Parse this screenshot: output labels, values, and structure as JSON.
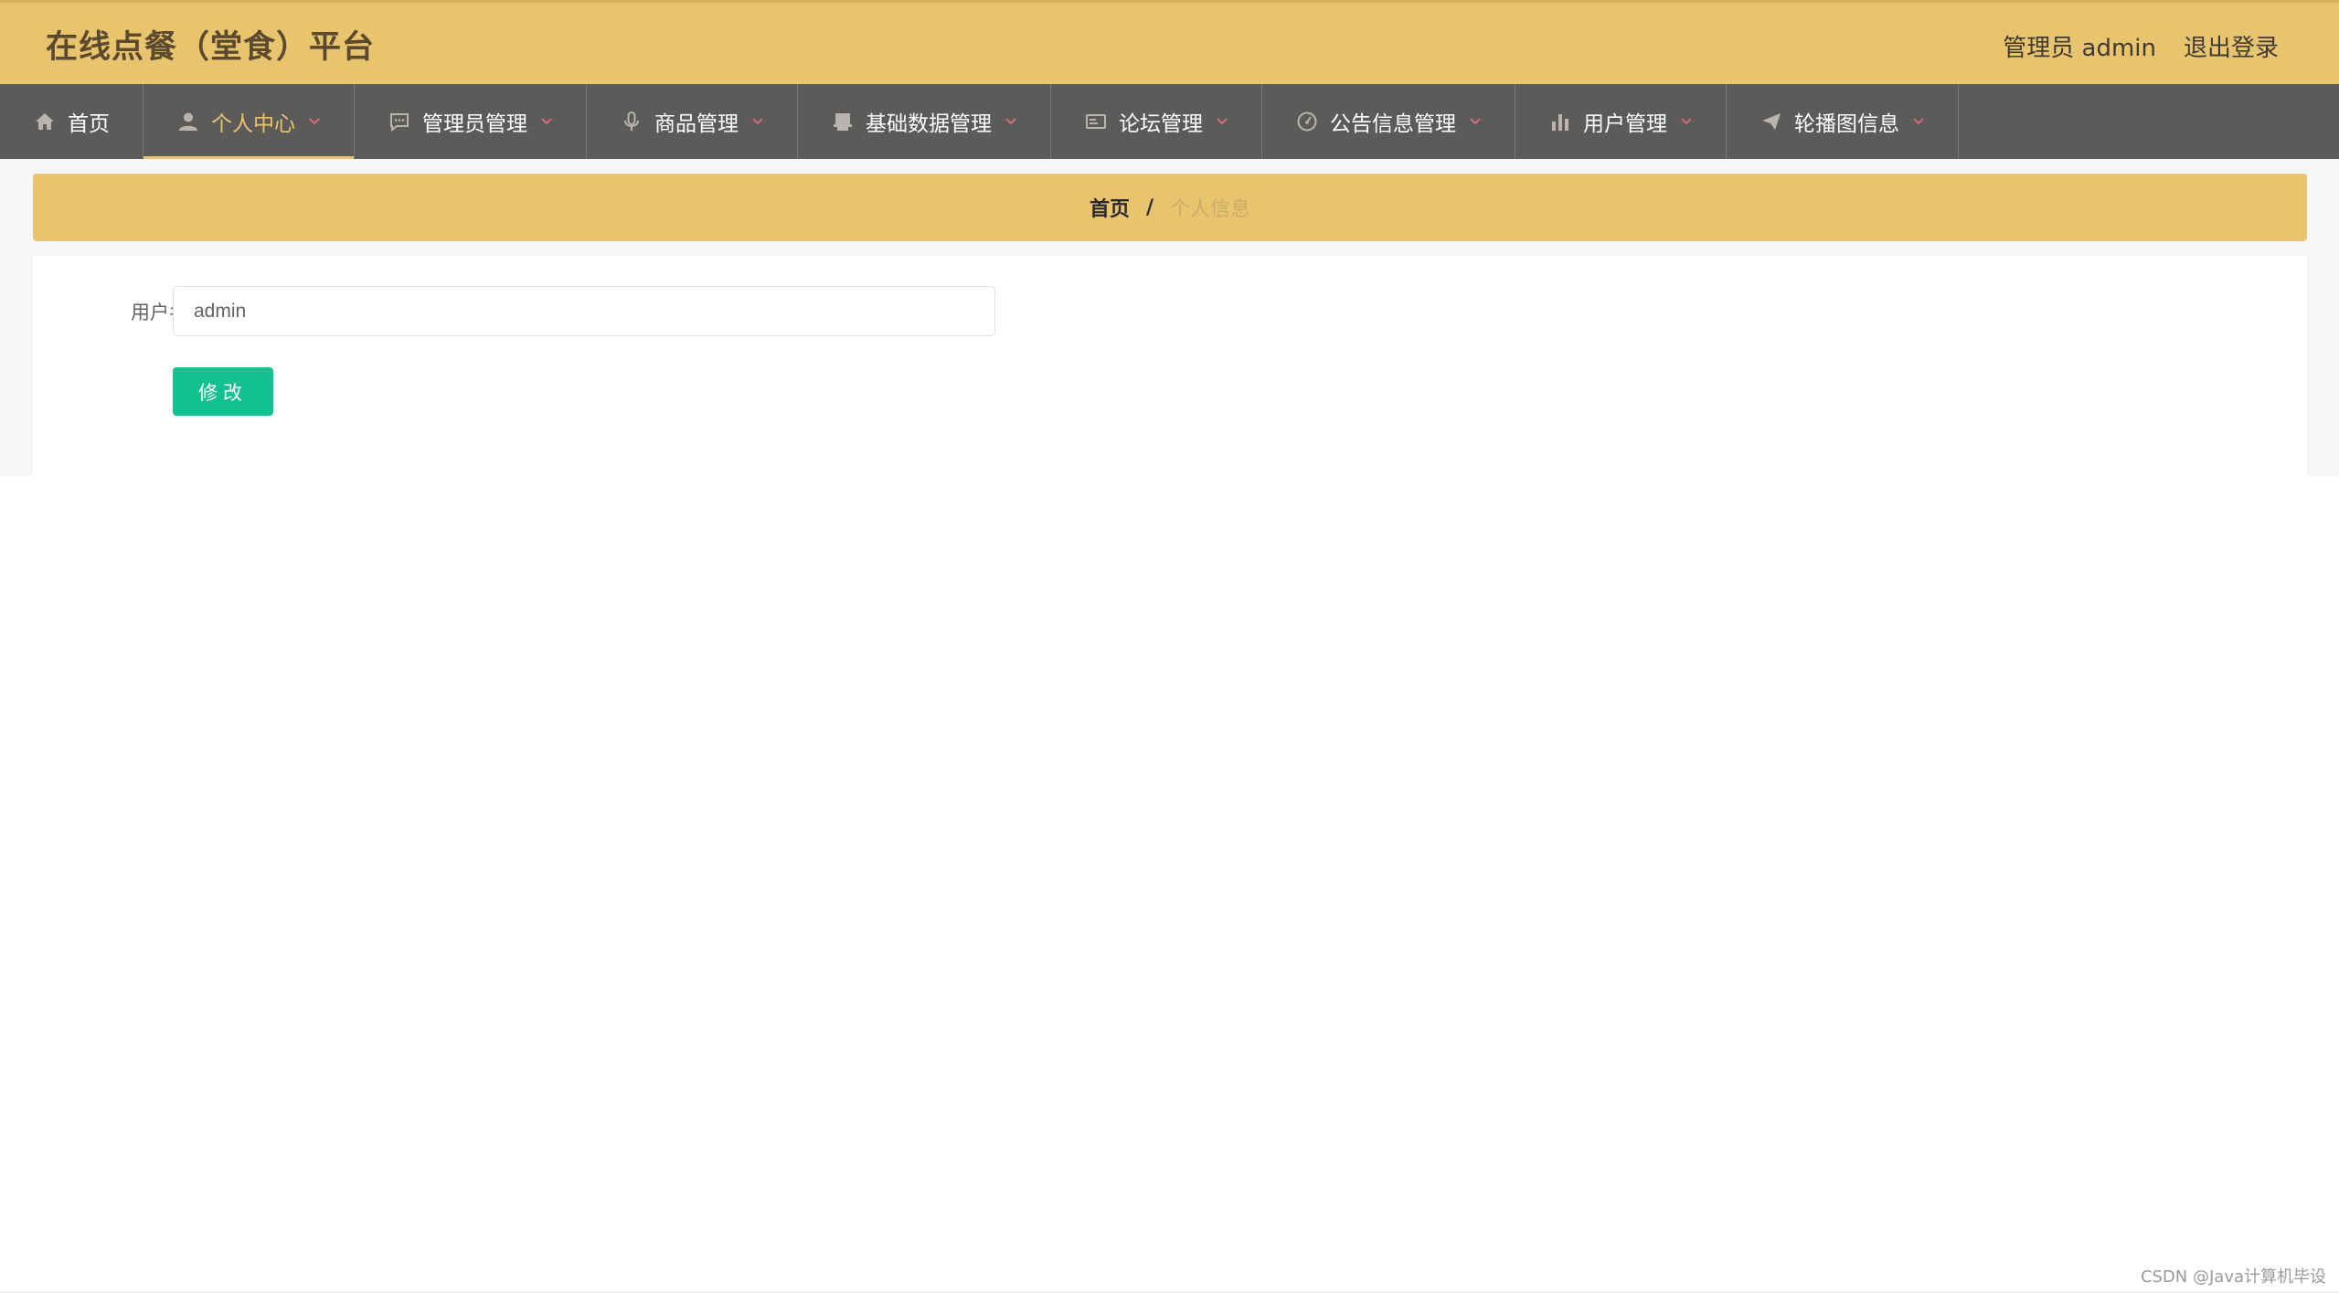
{
  "header": {
    "title": "在线点餐（堂食）平台",
    "user_label": "管理员 admin",
    "logout_label": "退出登录"
  },
  "nav": {
    "items": [
      {
        "label": "首页",
        "icon": "home-icon",
        "has_caret": false,
        "active": false
      },
      {
        "label": "个人中心",
        "icon": "user-icon",
        "has_caret": true,
        "active": true
      },
      {
        "label": "管理员管理",
        "icon": "chat-icon",
        "has_caret": true,
        "active": false
      },
      {
        "label": "商品管理",
        "icon": "microphone-icon",
        "has_caret": true,
        "active": false
      },
      {
        "label": "基础数据管理",
        "icon": "printer-icon",
        "has_caret": true,
        "active": false
      },
      {
        "label": "论坛管理",
        "icon": "postcard-icon",
        "has_caret": true,
        "active": false
      },
      {
        "label": "公告信息管理",
        "icon": "gauge-icon",
        "has_caret": true,
        "active": false
      },
      {
        "label": "用户管理",
        "icon": "bar-chart-icon",
        "has_caret": true,
        "active": false
      },
      {
        "label": "轮播图信息",
        "icon": "paper-plane-icon",
        "has_caret": true,
        "active": false
      }
    ]
  },
  "breadcrumb": {
    "home": "首页",
    "separator": "/",
    "current": "个人信息"
  },
  "form": {
    "username_label": "用户名",
    "username_value": "admin",
    "submit_label": "修改"
  },
  "watermark": "CSDN @Java计算机毕设",
  "colors": {
    "header_bg": "#e8c46f",
    "nav_bg": "#5d5b59",
    "nav_active": "#e8c46f",
    "caret": "#e06b8a",
    "button": "#13c08f"
  }
}
